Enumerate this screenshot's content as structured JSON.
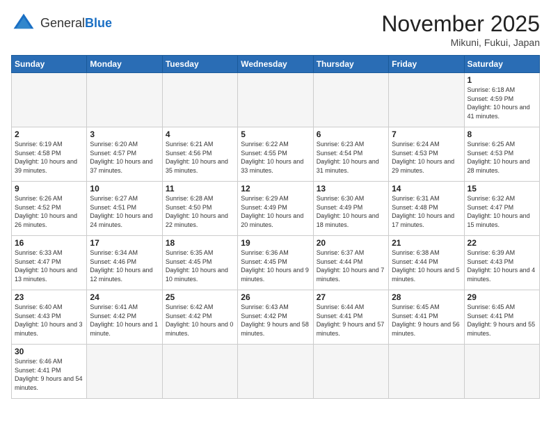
{
  "header": {
    "logo_general": "General",
    "logo_blue": "Blue",
    "month_title": "November 2025",
    "location": "Mikuni, Fukui, Japan"
  },
  "weekdays": [
    "Sunday",
    "Monday",
    "Tuesday",
    "Wednesday",
    "Thursday",
    "Friday",
    "Saturday"
  ],
  "weeks": [
    [
      {
        "date": "",
        "info": ""
      },
      {
        "date": "",
        "info": ""
      },
      {
        "date": "",
        "info": ""
      },
      {
        "date": "",
        "info": ""
      },
      {
        "date": "",
        "info": ""
      },
      {
        "date": "",
        "info": ""
      },
      {
        "date": "1",
        "info": "Sunrise: 6:18 AM\nSunset: 4:59 PM\nDaylight: 10 hours\nand 41 minutes."
      }
    ],
    [
      {
        "date": "2",
        "info": "Sunrise: 6:19 AM\nSunset: 4:58 PM\nDaylight: 10 hours\nand 39 minutes."
      },
      {
        "date": "3",
        "info": "Sunrise: 6:20 AM\nSunset: 4:57 PM\nDaylight: 10 hours\nand 37 minutes."
      },
      {
        "date": "4",
        "info": "Sunrise: 6:21 AM\nSunset: 4:56 PM\nDaylight: 10 hours\nand 35 minutes."
      },
      {
        "date": "5",
        "info": "Sunrise: 6:22 AM\nSunset: 4:55 PM\nDaylight: 10 hours\nand 33 minutes."
      },
      {
        "date": "6",
        "info": "Sunrise: 6:23 AM\nSunset: 4:54 PM\nDaylight: 10 hours\nand 31 minutes."
      },
      {
        "date": "7",
        "info": "Sunrise: 6:24 AM\nSunset: 4:53 PM\nDaylight: 10 hours\nand 29 minutes."
      },
      {
        "date": "8",
        "info": "Sunrise: 6:25 AM\nSunset: 4:53 PM\nDaylight: 10 hours\nand 28 minutes."
      }
    ],
    [
      {
        "date": "9",
        "info": "Sunrise: 6:26 AM\nSunset: 4:52 PM\nDaylight: 10 hours\nand 26 minutes."
      },
      {
        "date": "10",
        "info": "Sunrise: 6:27 AM\nSunset: 4:51 PM\nDaylight: 10 hours\nand 24 minutes."
      },
      {
        "date": "11",
        "info": "Sunrise: 6:28 AM\nSunset: 4:50 PM\nDaylight: 10 hours\nand 22 minutes."
      },
      {
        "date": "12",
        "info": "Sunrise: 6:29 AM\nSunset: 4:49 PM\nDaylight: 10 hours\nand 20 minutes."
      },
      {
        "date": "13",
        "info": "Sunrise: 6:30 AM\nSunset: 4:49 PM\nDaylight: 10 hours\nand 18 minutes."
      },
      {
        "date": "14",
        "info": "Sunrise: 6:31 AM\nSunset: 4:48 PM\nDaylight: 10 hours\nand 17 minutes."
      },
      {
        "date": "15",
        "info": "Sunrise: 6:32 AM\nSunset: 4:47 PM\nDaylight: 10 hours\nand 15 minutes."
      }
    ],
    [
      {
        "date": "16",
        "info": "Sunrise: 6:33 AM\nSunset: 4:47 PM\nDaylight: 10 hours\nand 13 minutes."
      },
      {
        "date": "17",
        "info": "Sunrise: 6:34 AM\nSunset: 4:46 PM\nDaylight: 10 hours\nand 12 minutes."
      },
      {
        "date": "18",
        "info": "Sunrise: 6:35 AM\nSunset: 4:45 PM\nDaylight: 10 hours\nand 10 minutes."
      },
      {
        "date": "19",
        "info": "Sunrise: 6:36 AM\nSunset: 4:45 PM\nDaylight: 10 hours\nand 9 minutes."
      },
      {
        "date": "20",
        "info": "Sunrise: 6:37 AM\nSunset: 4:44 PM\nDaylight: 10 hours\nand 7 minutes."
      },
      {
        "date": "21",
        "info": "Sunrise: 6:38 AM\nSunset: 4:44 PM\nDaylight: 10 hours\nand 5 minutes."
      },
      {
        "date": "22",
        "info": "Sunrise: 6:39 AM\nSunset: 4:43 PM\nDaylight: 10 hours\nand 4 minutes."
      }
    ],
    [
      {
        "date": "23",
        "info": "Sunrise: 6:40 AM\nSunset: 4:43 PM\nDaylight: 10 hours\nand 3 minutes."
      },
      {
        "date": "24",
        "info": "Sunrise: 6:41 AM\nSunset: 4:42 PM\nDaylight: 10 hours\nand 1 minute."
      },
      {
        "date": "25",
        "info": "Sunrise: 6:42 AM\nSunset: 4:42 PM\nDaylight: 10 hours\nand 0 minutes."
      },
      {
        "date": "26",
        "info": "Sunrise: 6:43 AM\nSunset: 4:42 PM\nDaylight: 9 hours\nand 58 minutes."
      },
      {
        "date": "27",
        "info": "Sunrise: 6:44 AM\nSunset: 4:41 PM\nDaylight: 9 hours\nand 57 minutes."
      },
      {
        "date": "28",
        "info": "Sunrise: 6:45 AM\nSunset: 4:41 PM\nDaylight: 9 hours\nand 56 minutes."
      },
      {
        "date": "29",
        "info": "Sunrise: 6:45 AM\nSunset: 4:41 PM\nDaylight: 9 hours\nand 55 minutes."
      }
    ],
    [
      {
        "date": "30",
        "info": "Sunrise: 6:46 AM\nSunset: 4:41 PM\nDaylight: 9 hours\nand 54 minutes."
      },
      {
        "date": "",
        "info": ""
      },
      {
        "date": "",
        "info": ""
      },
      {
        "date": "",
        "info": ""
      },
      {
        "date": "",
        "info": ""
      },
      {
        "date": "",
        "info": ""
      },
      {
        "date": "",
        "info": ""
      }
    ]
  ]
}
